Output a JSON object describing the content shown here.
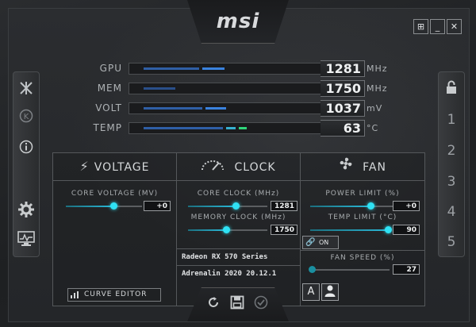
{
  "app": {
    "logo": "msi"
  },
  "window_buttons": [
    {
      "name": "windows-icon",
      "glyph": "⊞"
    },
    {
      "name": "minimize-icon",
      "glyph": "_"
    },
    {
      "name": "close-icon",
      "glyph": "✕"
    }
  ],
  "left_sidebar": [
    "kombustor-icon",
    "k-icon",
    "info-icon",
    "gear-icon",
    "monitor-icon"
  ],
  "right_sidebar": {
    "lock_icon": "lock-icon",
    "profiles": [
      "1",
      "2",
      "3",
      "4",
      "5"
    ]
  },
  "metrics": [
    {
      "label": "GPU",
      "value": "1281",
      "unit": "MHz"
    },
    {
      "label": "MEM",
      "value": "1750",
      "unit": "MHz"
    },
    {
      "label": "VOLT",
      "value": "1037",
      "unit": "mV"
    },
    {
      "label": "TEMP",
      "value": "63",
      "unit": "°C"
    }
  ],
  "voltage": {
    "title": "VOLTAGE",
    "core_voltage_label": "CORE VOLTAGE (MV)",
    "core_voltage_value": "+0",
    "core_voltage_level": 0.5,
    "curve_editor_label": "CURVE EDITOR"
  },
  "clock": {
    "title": "CLOCK",
    "core_clock_label": "CORE CLOCK (MHz)",
    "core_clock_value": "1281",
    "core_clock_level": 0.5,
    "memory_clock_label": "MEMORY CLOCK (MHz)",
    "memory_clock_value": "1750",
    "memory_clock_level": 0.5,
    "gpu_name": "Radeon RX 570 Series",
    "driver_version": "Adrenalin 2020 20.12.1"
  },
  "fan": {
    "title": "FAN",
    "power_limit_label": "POWER LIMIT (%)",
    "power_limit_value": "+0",
    "power_limit_level": 0.5,
    "temp_limit_label": "TEMP LIMIT (°C)",
    "temp_limit_value": "90",
    "temp_limit_level": 1.0,
    "link_toggle_label": "ON",
    "fan_speed_label": "FAN SPEED (%)",
    "fan_speed_value": "27",
    "fan_speed_level": 0.0,
    "auto_label": "A"
  },
  "bottom_actions": [
    "reset-icon",
    "save-icon",
    "apply-icon"
  ],
  "colors": {
    "accent": "#2fe2f4",
    "bar_blue": "#3a7fd9",
    "bar_green": "#2fd67a"
  }
}
